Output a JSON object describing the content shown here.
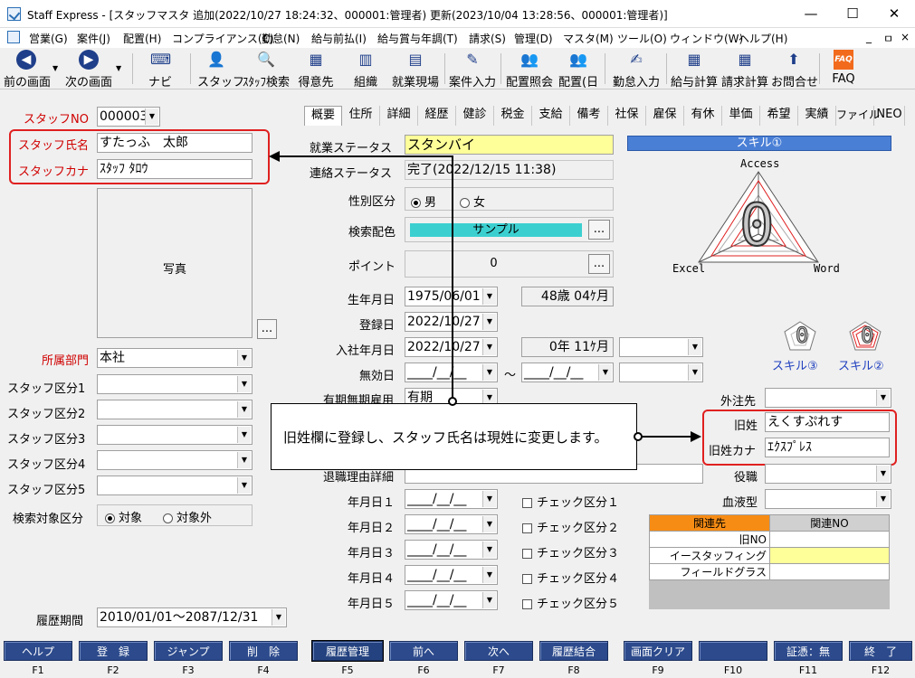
{
  "window": {
    "title": "Staff Express - [スタッフマスタ  追加(2022/10/27 18:24:32、000001:管理者)  更新(2023/10/04 13:28:56、000001:管理者)]",
    "min": "—",
    "max": "☐",
    "close": "✕"
  },
  "menu": {
    "items": [
      "営業(G)",
      "案件(J)",
      "配置(H)",
      "コンプライアンス(C)",
      "勤怠(N)",
      "給与前払(I)",
      "給与賞与年調(T)",
      "請求(S)",
      "管理(D)",
      "マスタ(M)",
      "ツール(O)",
      "ウィンドウ(W)",
      "ヘルプ(H)"
    ],
    "controls": [
      "_",
      "ㅁ",
      "×"
    ]
  },
  "toolbar": {
    "items": [
      "前の画面",
      "次の画面",
      "ナビ",
      "スタッフ",
      "ｽﾀｯﾌ検索",
      "得意先",
      "組織",
      "就業現場",
      "案件入力",
      "配置照会",
      "配置(日",
      "勤怠入力",
      "給与計算",
      "請求計算",
      "お問合せ",
      "FAQ"
    ],
    "faq_icon": "FAQ"
  },
  "left": {
    "staff_no_label": "スタッフNO",
    "staff_no": "000003",
    "name_label": "スタッフ氏名",
    "name": "すたっふ　太郎",
    "kana_label": "スタッフカナ",
    "kana": "ｽﾀｯﾌ ﾀﾛｳ",
    "photo_label": "写真",
    "photo_btn": "...",
    "dept_label": "所属部門",
    "dept": "本社",
    "kubun": [
      {
        "label": "スタッフ区分1",
        "value": ""
      },
      {
        "label": "スタッフ区分2",
        "value": ""
      },
      {
        "label": "スタッフ区分3",
        "value": ""
      },
      {
        "label": "スタッフ区分4",
        "value": ""
      },
      {
        "label": "スタッフ区分5",
        "value": ""
      }
    ],
    "search_target_label": "検索対象区分",
    "search_target_on": "対象",
    "search_target_off": "対象外",
    "history_label": "履歴期間",
    "history": "2010/01/01～2087/12/31"
  },
  "tabs": [
    "概要",
    "住所",
    "詳細",
    "経歴",
    "健診",
    "税金",
    "支給",
    "備考",
    "社保",
    "雇保",
    "有休",
    "単価",
    "希望",
    "実績",
    "ファイル",
    "NEO"
  ],
  "main": {
    "work_status_label": "就業ステータス",
    "work_status": "スタンバイ",
    "contact_status_label": "連絡ステータス",
    "contact_status": "完了(2022/12/15 11:38)",
    "gender_label": "性別区分",
    "gender_m": "男",
    "gender_f": "女",
    "color_label": "検索配色",
    "color_sample": "サンプル",
    "color_btn": "...",
    "point_label": "ポイント",
    "point": "0",
    "point_btn": "...",
    "birth_label": "生年月日",
    "birth": "1975/06/01",
    "age": "48歳 04ｹ月",
    "reg_label": "登録日",
    "reg": "2022/10/27",
    "join_label": "入社年月日",
    "join": "2022/10/27",
    "tenure": "0年  11ｹ月",
    "invalid_label": "無効日",
    "invalid_from": "____/__/__",
    "tilde": "～",
    "invalid_to": "____/__/__",
    "term_label": "有期無期雇用",
    "term": "有期",
    "retire_label": "退職理由詳細",
    "dates": [
      {
        "label": "年月日１",
        "value": "____/__/__",
        "check": "チェック区分１"
      },
      {
        "label": "年月日２",
        "value": "____/__/__",
        "check": "チェック区分２"
      },
      {
        "label": "年月日３",
        "value": "____/__/__",
        "check": "チェック区分３"
      },
      {
        "label": "年月日４",
        "value": "____/__/__",
        "check": "チェック区分４"
      },
      {
        "label": "年月日５",
        "value": "____/__/__",
        "check": "チェック区分５"
      }
    ]
  },
  "right": {
    "skill_header": "スキル①",
    "radar_labels": {
      "top": "Access",
      "left": "Excel",
      "right": "Word"
    },
    "radar_center": "0",
    "skill3": "スキル③",
    "skill2": "スキル②",
    "mini_center": "0",
    "outsource_label": "外注先",
    "old_name_label": "旧姓",
    "old_name": "えくすぷれす",
    "old_kana_label": "旧姓カナ",
    "old_kana": "ｴｸｽﾌﾟﾚｽ",
    "role_label": "役職",
    "blood_label": "血液型",
    "rel_headers": [
      "関連先",
      "関連NO"
    ],
    "rel_rows": [
      "旧NO",
      "イースタッフィング",
      "フィールドグラス"
    ]
  },
  "callout": "旧姓欄に登録し、スタッフ氏名は現姓に変更します。",
  "fnbar": [
    {
      "label": "ヘルプ",
      "key": "F1"
    },
    {
      "label": "登　録",
      "key": "F2"
    },
    {
      "label": "ジャンプ",
      "key": "F3"
    },
    {
      "label": "削　除",
      "key": "F4"
    },
    {
      "label": "履歴管理",
      "key": "F5"
    },
    {
      "label": "前へ",
      "key": "F6"
    },
    {
      "label": "次へ",
      "key": "F7"
    },
    {
      "label": "履歴結合",
      "key": "F8"
    },
    {
      "label": "画面クリア",
      "key": "F9"
    },
    {
      "label": "",
      "key": "F10"
    },
    {
      "label": "証憑：無",
      "key": "F11"
    },
    {
      "label": "終　了",
      "key": "F12"
    }
  ],
  "colors": {
    "accent_red": "#e02020",
    "label_red": "#d00000",
    "skill_header": "#4a7fd6",
    "color_sample": "#3ccfd0",
    "fn_button": "#2c4a8c",
    "rel_header": "#f78c14",
    "yellow": "#ffff99"
  }
}
